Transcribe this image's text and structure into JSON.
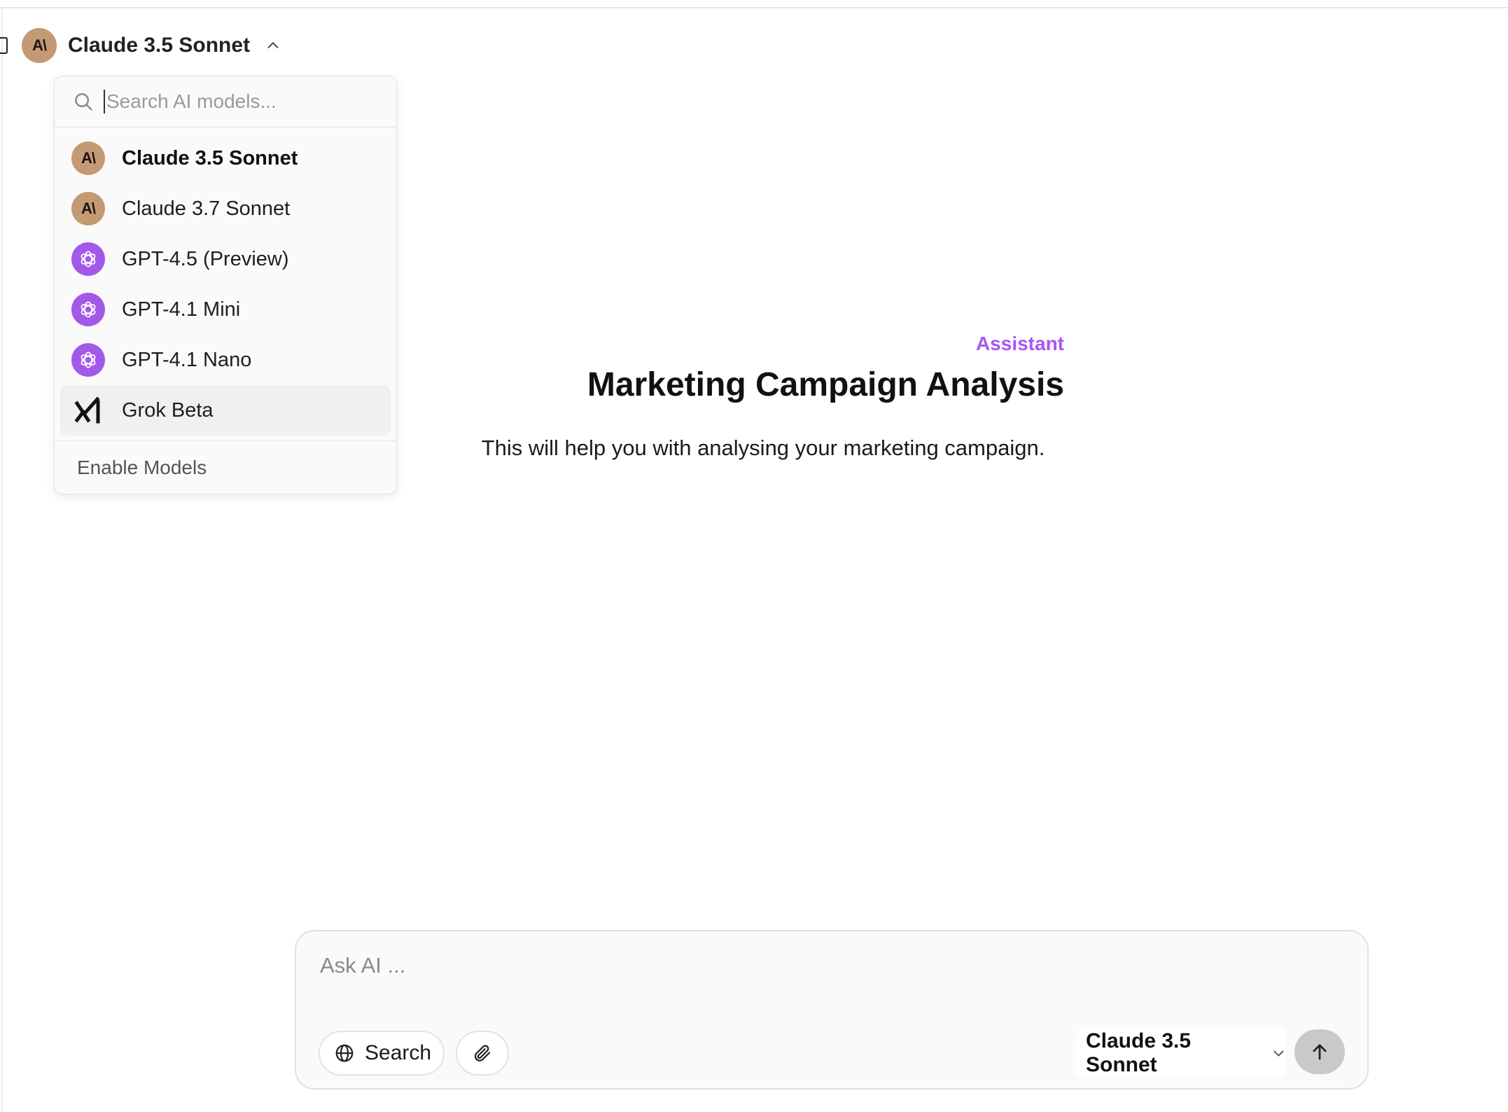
{
  "header": {
    "selected_model": "Claude 3.5 Sonnet",
    "avatar_text": "A\\"
  },
  "dropdown": {
    "search_placeholder": "Search AI models...",
    "models": [
      {
        "label": "Claude 3.5 Sonnet",
        "icon": "anthropic-icon",
        "selected": true
      },
      {
        "label": "Claude 3.7 Sonnet",
        "icon": "anthropic-icon"
      },
      {
        "label": "GPT-4.5 (Preview)",
        "icon": "openai-icon"
      },
      {
        "label": "GPT-4.1 Mini",
        "icon": "openai-icon"
      },
      {
        "label": "GPT-4.1 Nano",
        "icon": "openai-icon"
      },
      {
        "label": "Grok Beta",
        "icon": "xai-icon",
        "hovered": true
      }
    ],
    "enable_label": "Enable Models"
  },
  "main": {
    "role": "Assistant",
    "title": "Marketing Campaign Analysis",
    "description": "This will help you with analysing your marketing campaign."
  },
  "composer": {
    "placeholder": "Ask AI ...",
    "search_label": "Search",
    "model_label": "Claude 3.5 Sonnet"
  },
  "colors": {
    "accent": "#a855f7",
    "anthropic_bg": "#c49a74",
    "openai_bg": "#a259e8",
    "send_bg": "#c9c9c9"
  }
}
